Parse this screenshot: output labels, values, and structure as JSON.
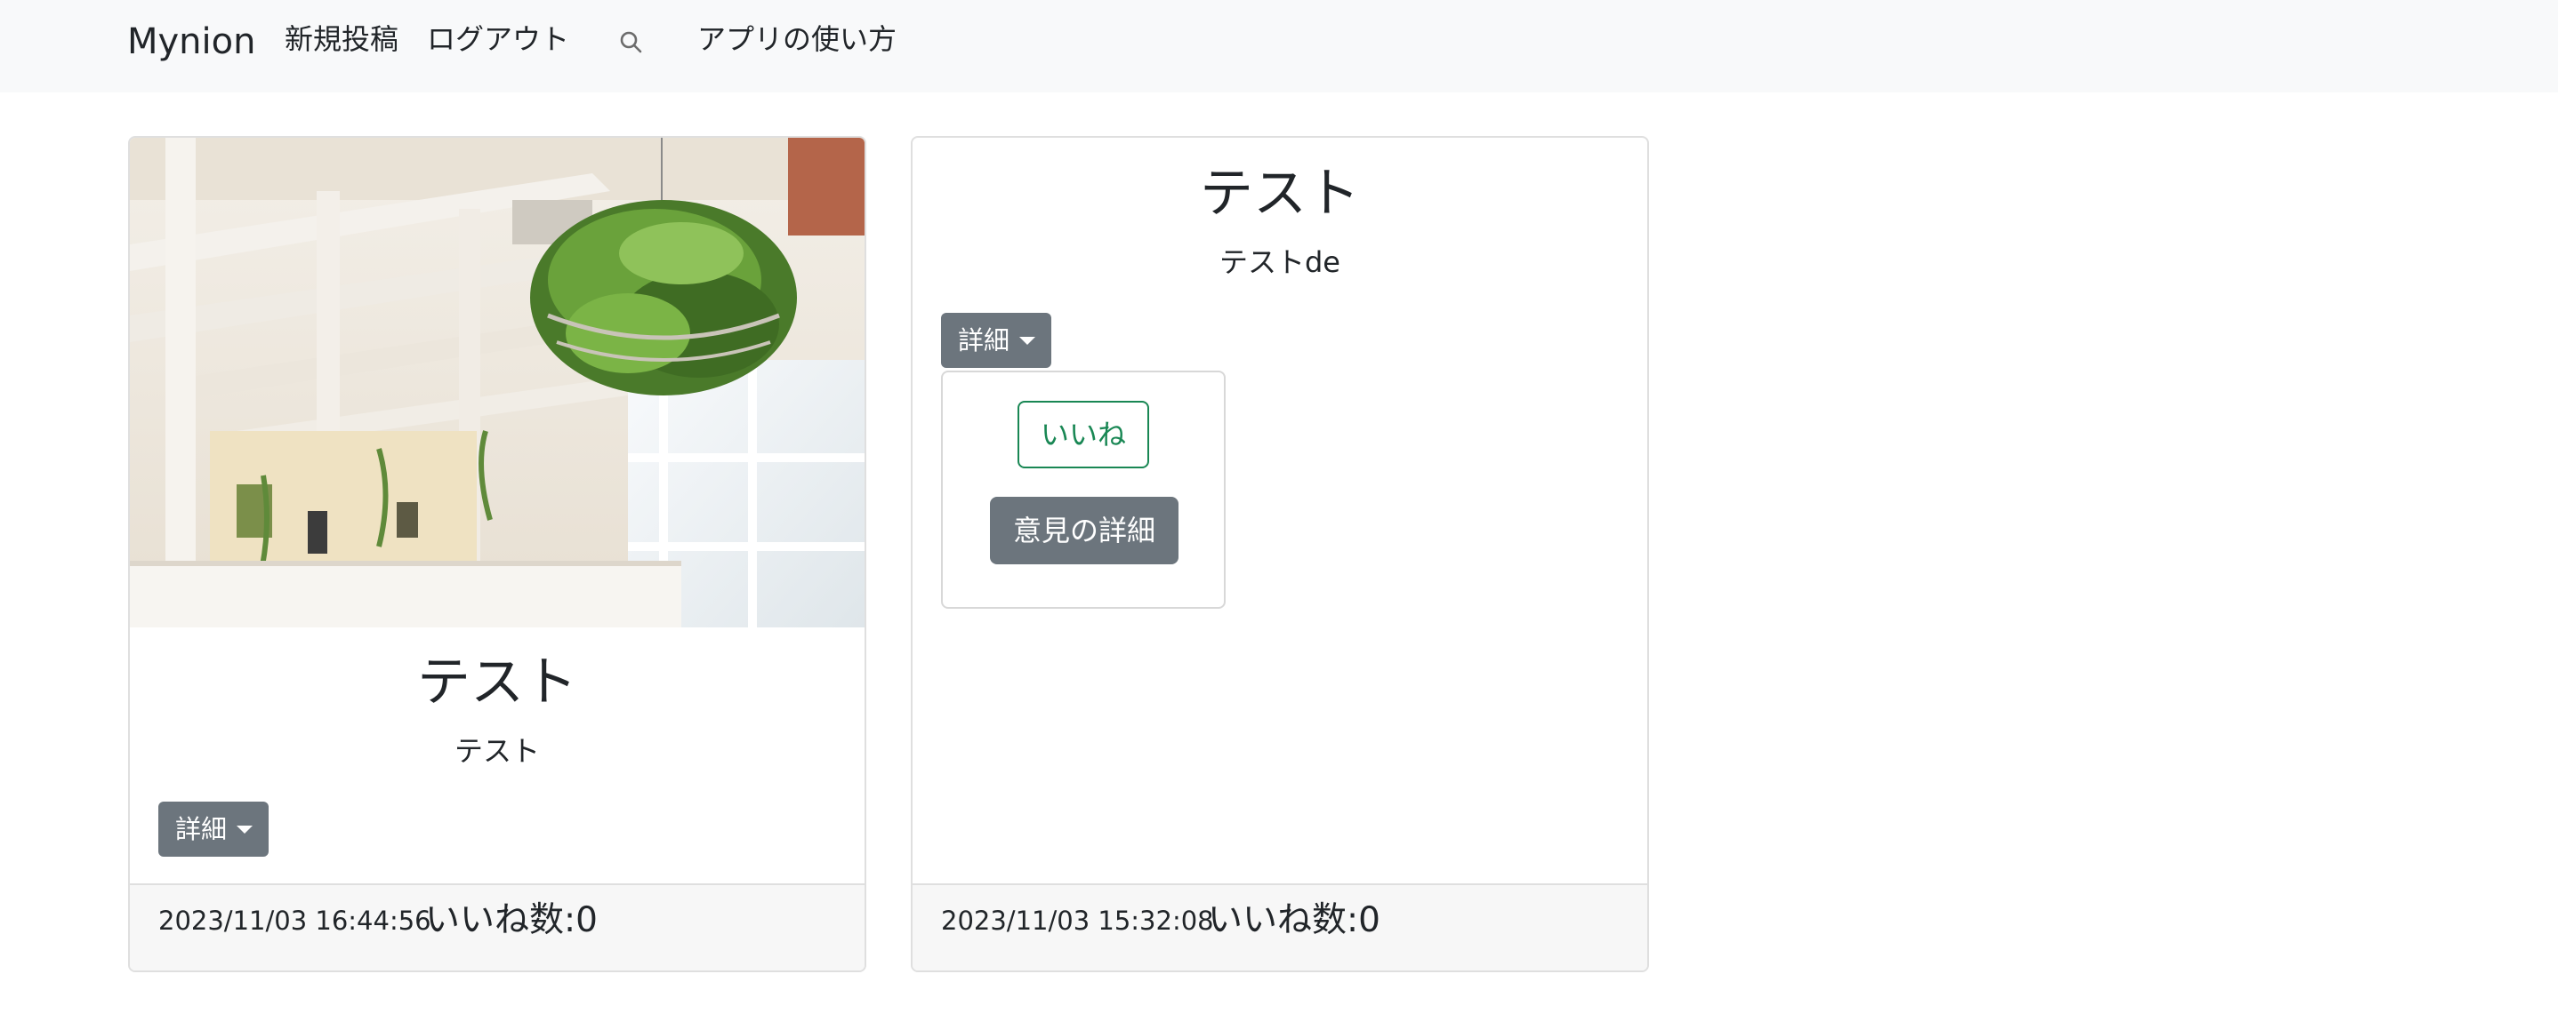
{
  "navbar": {
    "brand": "Mynion",
    "links": {
      "new_post": "新規投稿",
      "logout": "ログアウト",
      "how_to_use": "アプリの使い方"
    },
    "search_icon": "search-icon"
  },
  "posts": [
    {
      "title": "テスト",
      "text": "テスト",
      "detail_label": "詳細",
      "has_image": true,
      "timestamp": "2023/11/03 16:44:56",
      "likes_label": "いいね数:0"
    },
    {
      "title": "テスト",
      "text": "テストde",
      "detail_label": "詳細",
      "has_image": false,
      "dropdown_open": true,
      "dropdown": {
        "like_label": "いいね",
        "opinion_detail_label": "意見の詳細"
      },
      "timestamp": "2023/11/03 15:32:08",
      "likes_label": "いいね数:0"
    }
  ],
  "colors": {
    "navbar_bg": "#f8f9fa",
    "secondary_button": "#6c757d",
    "success_outline": "#198754",
    "card_border": "#dfdfdf",
    "footer_bg": "#f7f7f7"
  }
}
